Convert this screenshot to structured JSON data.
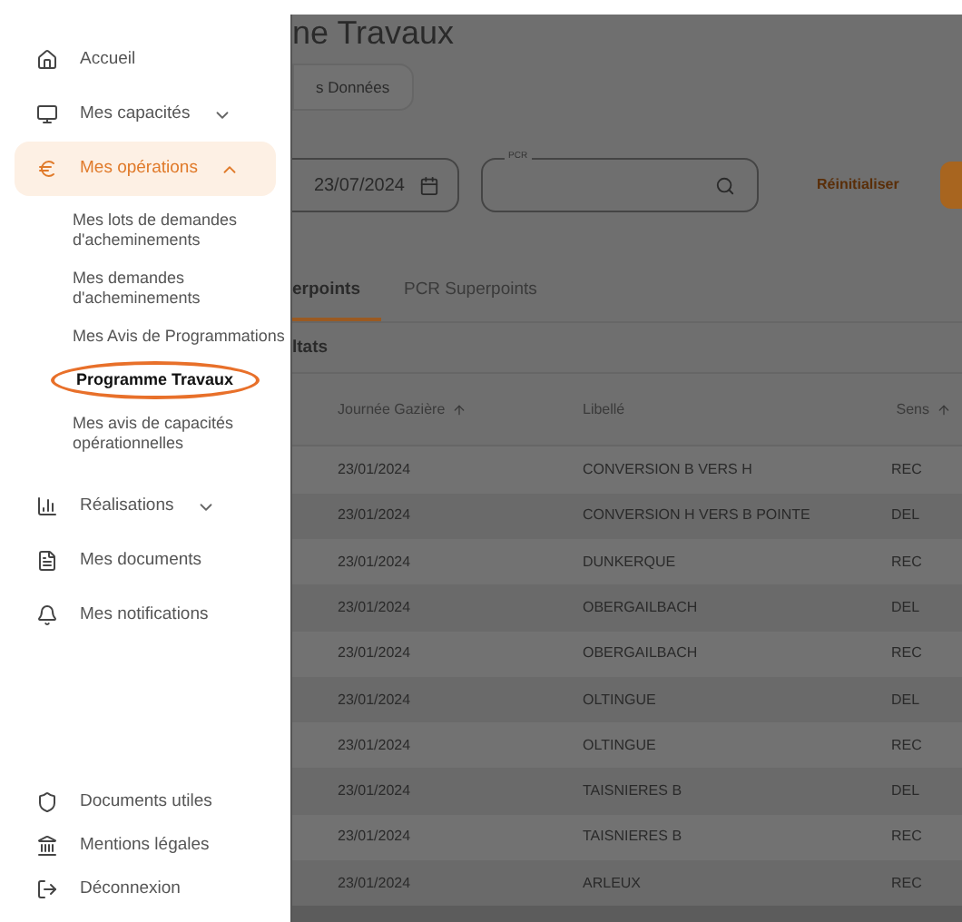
{
  "sidebar": {
    "items": [
      {
        "label": "Accueil",
        "selected": false
      },
      {
        "label": "Mes capacités",
        "selected": false,
        "expanded": false
      },
      {
        "label": "Mes opérations",
        "selected": true,
        "expanded": true,
        "children": [
          {
            "label": "Mes lots de demandes d'acheminements",
            "selected": false
          },
          {
            "label": "Mes demandes d'acheminements",
            "selected": false
          },
          {
            "label": "Mes Avis de Programmations",
            "selected": false
          },
          {
            "label": "Programme Travaux",
            "selected": true
          },
          {
            "label": "Mes avis de capacités opérationnelles",
            "selected": false
          }
        ]
      },
      {
        "label": "Réalisations",
        "selected": false,
        "expanded": false
      },
      {
        "label": "Mes documents",
        "selected": false
      },
      {
        "label": "Mes notifications",
        "selected": false
      }
    ],
    "footer_items": [
      {
        "label": "Documents utiles"
      },
      {
        "label": "Mentions légales"
      },
      {
        "label": "Déconnexion"
      }
    ]
  },
  "main": {
    "title": "ne Travaux",
    "data_button": "s Données",
    "date_field": {
      "value": "23/07/2024"
    },
    "pcr_field": {
      "label": "PCR"
    },
    "reset_link": "Réinitialiser",
    "tabs": [
      {
        "label": "erpoints",
        "selected": true
      },
      {
        "label": "PCR Superpoints",
        "selected": false
      }
    ],
    "results_label": "ltats",
    "table": {
      "columns": [
        {
          "label": "Journée Gazière",
          "sorted": true
        },
        {
          "label": "Libellé",
          "sorted": false
        },
        {
          "label": "Sens",
          "sorted": true
        }
      ],
      "rows": [
        [
          "23/01/2024",
          "CONVERSION B VERS H",
          "REC"
        ],
        [
          "23/01/2024",
          "CONVERSION H VERS B POINTE",
          "DEL"
        ],
        [
          "23/01/2024",
          "DUNKERQUE",
          "REC"
        ],
        [
          "23/01/2024",
          "OBERGAILBACH",
          "DEL"
        ],
        [
          "23/01/2024",
          "OBERGAILBACH",
          "REC"
        ],
        [
          "23/01/2024",
          "OLTINGUE",
          "DEL"
        ],
        [
          "23/01/2024",
          "OLTINGUE",
          "REC"
        ],
        [
          "23/01/2024",
          "TAISNIERES B",
          "DEL"
        ],
        [
          "23/01/2024",
          "TAISNIERES B",
          "REC"
        ],
        [
          "23/01/2024",
          "ARLEUX",
          "REC"
        ]
      ]
    }
  }
}
